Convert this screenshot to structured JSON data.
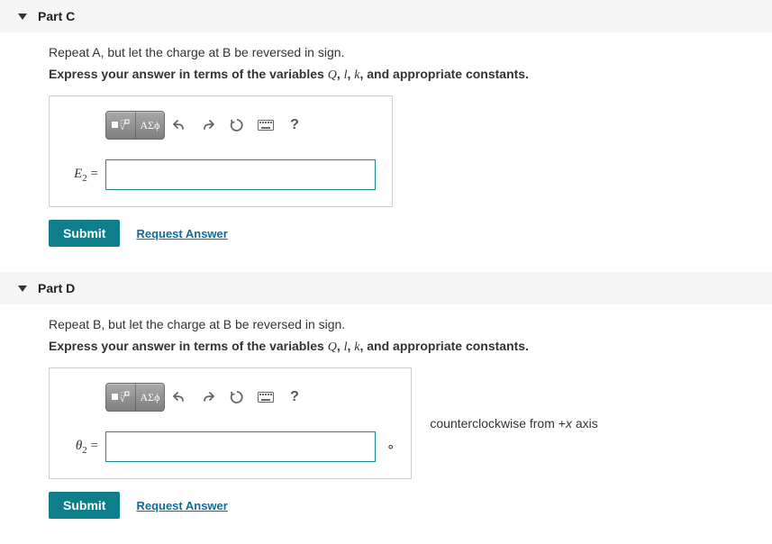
{
  "parts": {
    "c": {
      "title": "Part C",
      "instruction": "Repeat A, but let the charge at B be reversed in sign.",
      "express_prefix": "Express your answer in terms of the variables ",
      "vars": [
        "Q",
        "l",
        "k"
      ],
      "express_suffix": ", and appropriate constants.",
      "lhs_symbol": "E",
      "lhs_subscript": "2",
      "input_value": ""
    },
    "d": {
      "title": "Part D",
      "instruction": "Repeat B, but let the charge at B be reversed in sign.",
      "express_prefix": "Express your answer in terms of the variables ",
      "vars": [
        "Q",
        "l",
        "k"
      ],
      "express_suffix": ", and appropriate constants.",
      "lhs_symbol": "θ",
      "lhs_subscript": "2",
      "input_value": "",
      "unit_suffix": "∘",
      "trailing_pre": "counterclockwise from +",
      "trailing_var": "x",
      "trailing_post": " axis"
    }
  },
  "toolbar": {
    "templates_label": "templates",
    "symbols_label": "ΑΣϕ",
    "undo_label": "undo",
    "redo_label": "redo",
    "reset_label": "reset",
    "keyboard_label": "keyboard",
    "help_label": "?"
  },
  "actions": {
    "submit": "Submit",
    "request": "Request Answer"
  }
}
